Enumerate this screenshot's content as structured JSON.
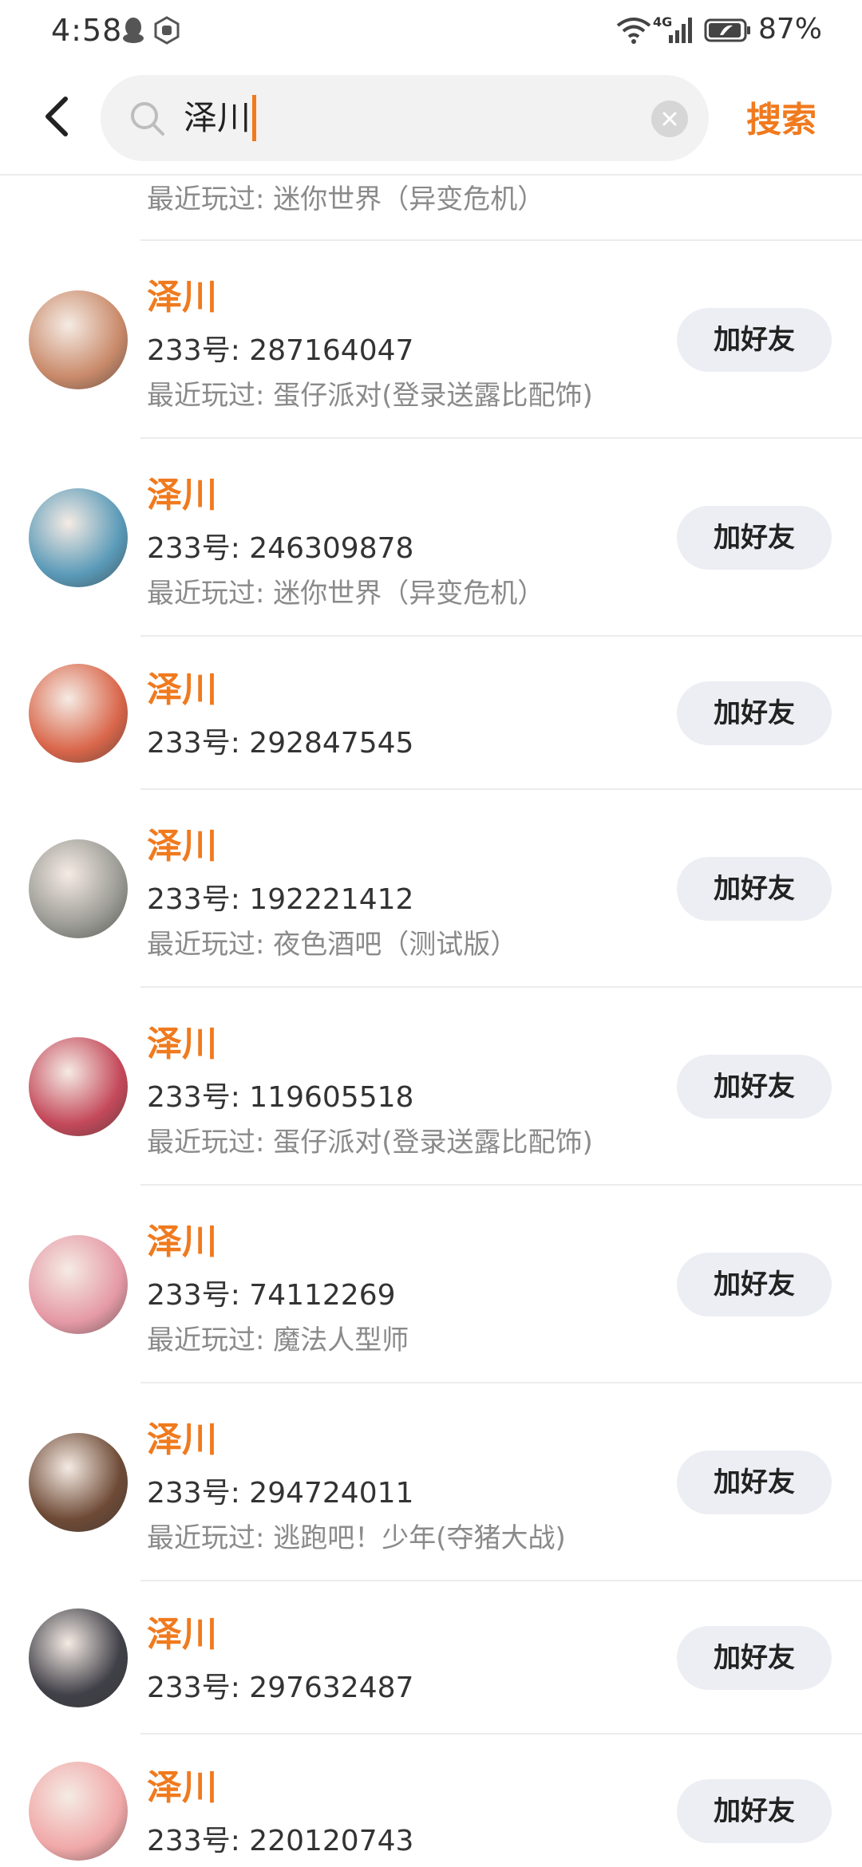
{
  "status_bar": {
    "time": "4:58",
    "network": "4G",
    "battery": "87%"
  },
  "search": {
    "query": "泽川",
    "search_label": "搜索"
  },
  "results": {
    "partial_recent": "最近玩过: 迷你世界（异变危机）",
    "add_label": "加好友",
    "items": [
      {
        "name": "泽川",
        "uid": "233号: 287164047",
        "recent": "最近玩过: 蛋仔派对(登录送露比配饰)",
        "avatar_color": "#c98a6a"
      },
      {
        "name": "泽川",
        "uid": "233号: 246309878",
        "recent": "最近玩过: 迷你世界（异变危机）",
        "avatar_color": "#5a9ab8"
      },
      {
        "name": "泽川",
        "uid": "233号: 292847545",
        "recent": "",
        "avatar_color": "#d9664a"
      },
      {
        "name": "泽川",
        "uid": "233号: 192221412",
        "recent": "最近玩过: 夜色酒吧（测试版）",
        "avatar_color": "#9a9a94"
      },
      {
        "name": "泽川",
        "uid": "233号: 119605518",
        "recent": "最近玩过: 蛋仔派对(登录送露比配饰)",
        "avatar_color": "#c4495a"
      },
      {
        "name": "泽川",
        "uid": "233号: 74112269",
        "recent": "最近玩过: 魔法人型师",
        "avatar_color": "#e59aa6"
      },
      {
        "name": "泽川",
        "uid": "233号: 294724011",
        "recent": "最近玩过: 逃跑吧！少年(夺猪大战)",
        "avatar_color": "#6e4a36"
      },
      {
        "name": "泽川",
        "uid": "233号: 297632487",
        "recent": "",
        "avatar_color": "#404048"
      },
      {
        "name": "泽川",
        "uid": "233号: 220120743",
        "recent": "",
        "avatar_color": "#f0a8a8"
      }
    ]
  },
  "colors": {
    "accent": "#f07a1e",
    "button_bg": "#eceef3",
    "muted_text": "#8a8a8a"
  }
}
